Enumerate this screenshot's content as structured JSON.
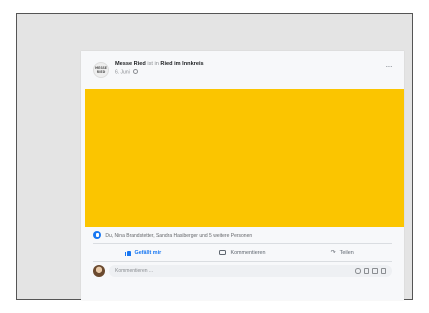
{
  "post": {
    "page_name": "Messe Ried",
    "at_text": "ist in",
    "place_name": "Ried im Innkreis",
    "date": "6. Juni",
    "logo_text": "MESSE RIED",
    "more_label": "···",
    "image_color": "#fbc500"
  },
  "reactions": {
    "text": "Du, Nina Brandstetter, Sandra Hasiberger und 5 weitere Personen"
  },
  "actions": {
    "like_label": "Gefällt mir",
    "comment_label": "Kommentieren",
    "share_label": "Teilen"
  },
  "comment": {
    "placeholder": "Kommentieren ..."
  },
  "icons": {
    "page_logo": "messe-ried-logo",
    "privacy": "globe-icon",
    "more": "more-options-icon",
    "reaction": "like-reaction-icon",
    "like": "thumbs-up-icon",
    "comment": "comment-bubble-icon",
    "share": "share-arrow-icon",
    "emoji": "emoji-icon",
    "camera": "camera-icon",
    "gif": "gif-icon",
    "sticker": "sticker-icon"
  },
  "colors": {
    "accent": "#1877f2",
    "background": "#e4e4e4",
    "card": "#f7f8fa"
  }
}
